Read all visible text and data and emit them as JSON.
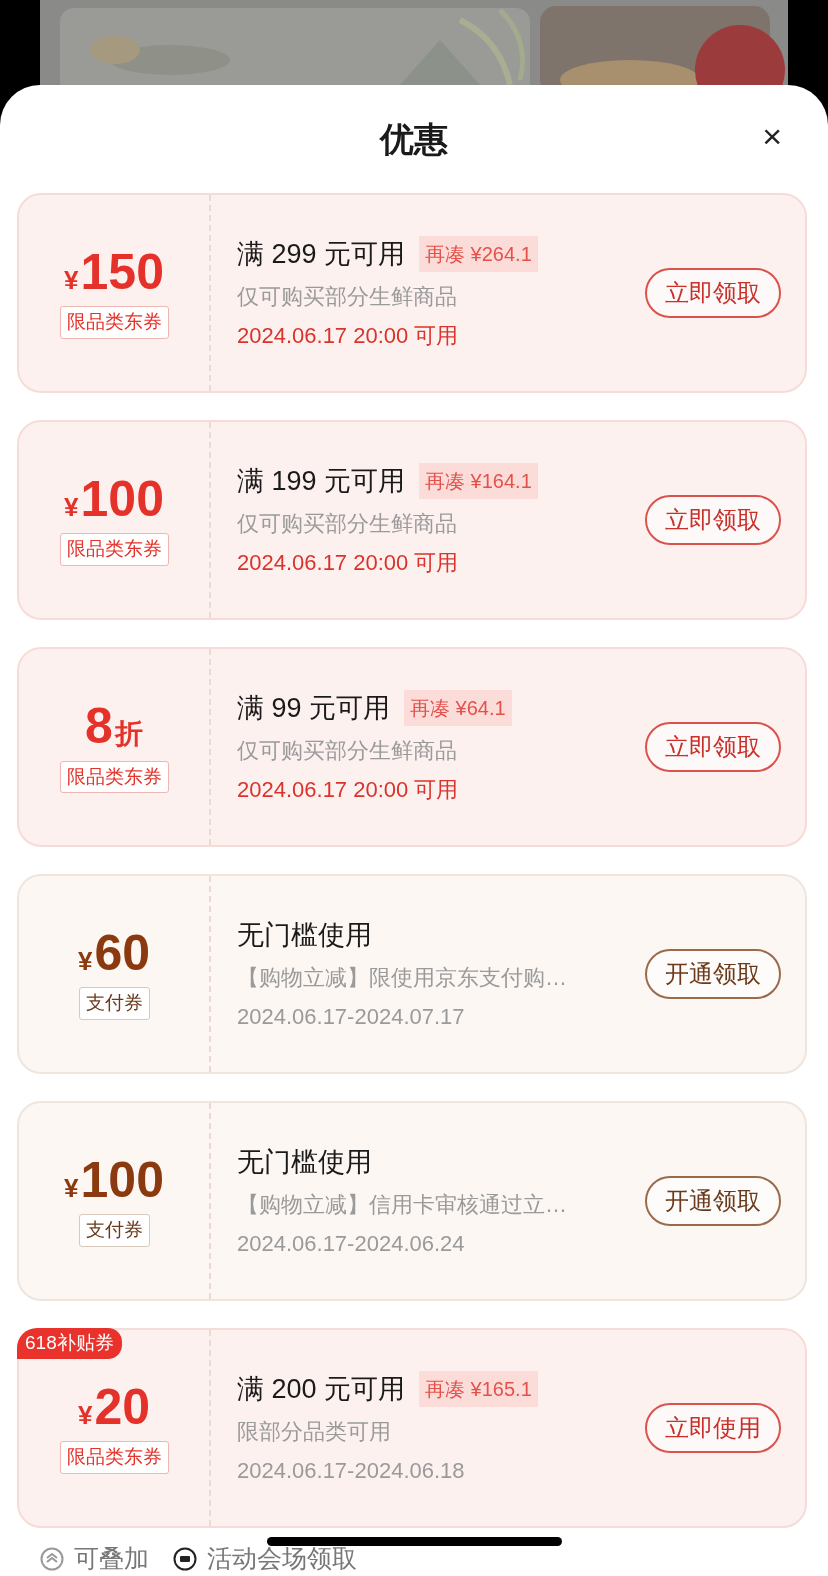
{
  "sheet": {
    "title": "优惠",
    "close": "×"
  },
  "coupons": [
    {
      "kind": "jd",
      "prefix": "¥",
      "amount": "150",
      "tag": "限品类东券",
      "condition": "满 299 元可用",
      "topup": "再凑 ¥264.1",
      "description": "仅可购买部分生鲜商品",
      "date": "2024.06.17 20:00 可用",
      "date_highlighted": true,
      "button": "立即领取"
    },
    {
      "kind": "jd",
      "prefix": "¥",
      "amount": "100",
      "tag": "限品类东券",
      "condition": "满 199 元可用",
      "topup": "再凑 ¥164.1",
      "description": "仅可购买部分生鲜商品",
      "date": "2024.06.17 20:00 可用",
      "date_highlighted": true,
      "button": "立即领取"
    },
    {
      "kind": "jd",
      "amount": "8",
      "suffix": "折",
      "tag": "限品类东券",
      "condition": "满 99 元可用",
      "topup": "再凑 ¥64.1",
      "description": "仅可购买部分生鲜商品",
      "date": "2024.06.17 20:00 可用",
      "date_highlighted": true,
      "button": "立即领取"
    },
    {
      "kind": "pay",
      "prefix": "¥",
      "amount": "60",
      "tag": "支付券",
      "condition": "无门槛使用",
      "description": "【购物立减】限使用京东支付购…",
      "date": "2024.06.17-2024.07.17",
      "date_highlighted": false,
      "button": "开通领取"
    },
    {
      "kind": "pay",
      "prefix": "¥",
      "amount": "100",
      "tag": "支付券",
      "condition": "无门槛使用",
      "description": "【购物立减】信用卡审核通过立…",
      "date": "2024.06.17-2024.06.24",
      "date_highlighted": false,
      "button": "开通领取"
    },
    {
      "kind": "jd",
      "badge": "618补贴券",
      "prefix": "¥",
      "amount": "20",
      "tag": "限品类东券",
      "condition": "满 200 元可用",
      "topup": "再凑 ¥165.1",
      "description": "限部分品类可用",
      "date": "2024.06.17-2024.06.18",
      "date_highlighted": false,
      "button": "立即使用"
    }
  ],
  "footer": [
    {
      "kind": "stack",
      "label": "可叠加"
    },
    {
      "kind": "venue",
      "label": "活动会场领取"
    }
  ]
}
